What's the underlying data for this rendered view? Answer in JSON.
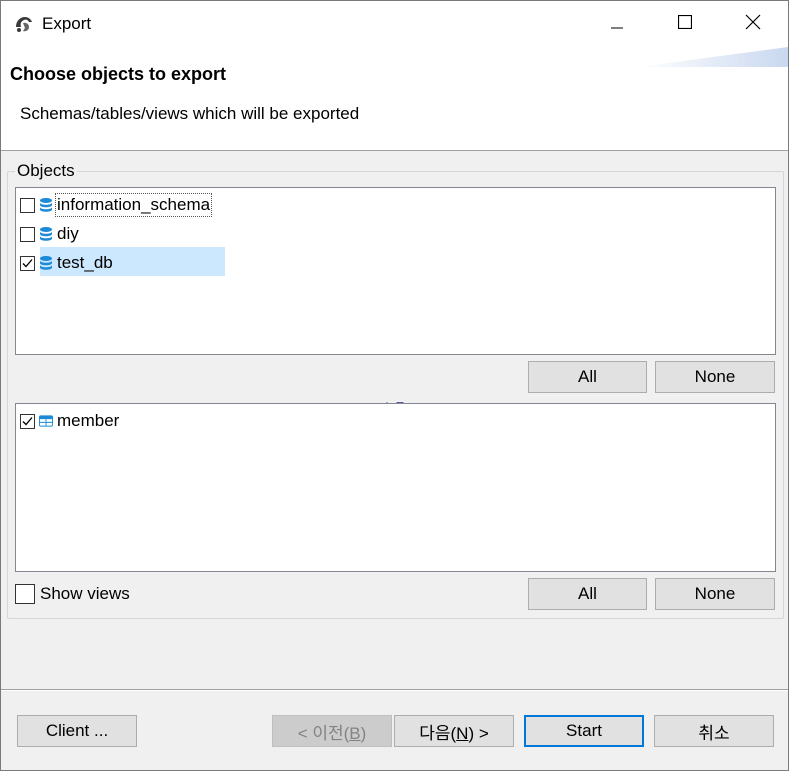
{
  "window": {
    "title": "Export",
    "icons": {
      "app": "app-logo-icon",
      "minimize": "minimize-icon",
      "maximize": "maximize-icon",
      "close": "close-icon"
    }
  },
  "header": {
    "title": "Choose objects to export",
    "description": "Schemas/tables/views which will be exported"
  },
  "objects": {
    "group_label": "Objects",
    "schemas": [
      {
        "label": "information_schema",
        "checked": false,
        "icon": "database-icon"
      },
      {
        "label": "diy",
        "checked": false,
        "icon": "database-icon"
      },
      {
        "label": "test_db",
        "checked": true,
        "icon": "database-icon",
        "selected": true
      }
    ],
    "schema_all_label": "All",
    "schema_none_label": "None",
    "tables": [
      {
        "label": "member",
        "checked": true,
        "icon": "table-icon"
      }
    ],
    "show_views_label": "Show views",
    "show_views_checked": false,
    "table_all_label": "All",
    "table_none_label": "None"
  },
  "footer": {
    "client_label": "Client ...",
    "back_prefix": "< 이전(",
    "back_key": "B",
    "back_suffix": ")",
    "next_prefix": "다음(",
    "next_key": "N",
    "next_suffix": ") >",
    "start_label": "Start",
    "cancel_label": "취소"
  },
  "colors": {
    "accent": "#0078d7",
    "selection": "#cce8ff",
    "db_icon": "#1c8ad6"
  }
}
